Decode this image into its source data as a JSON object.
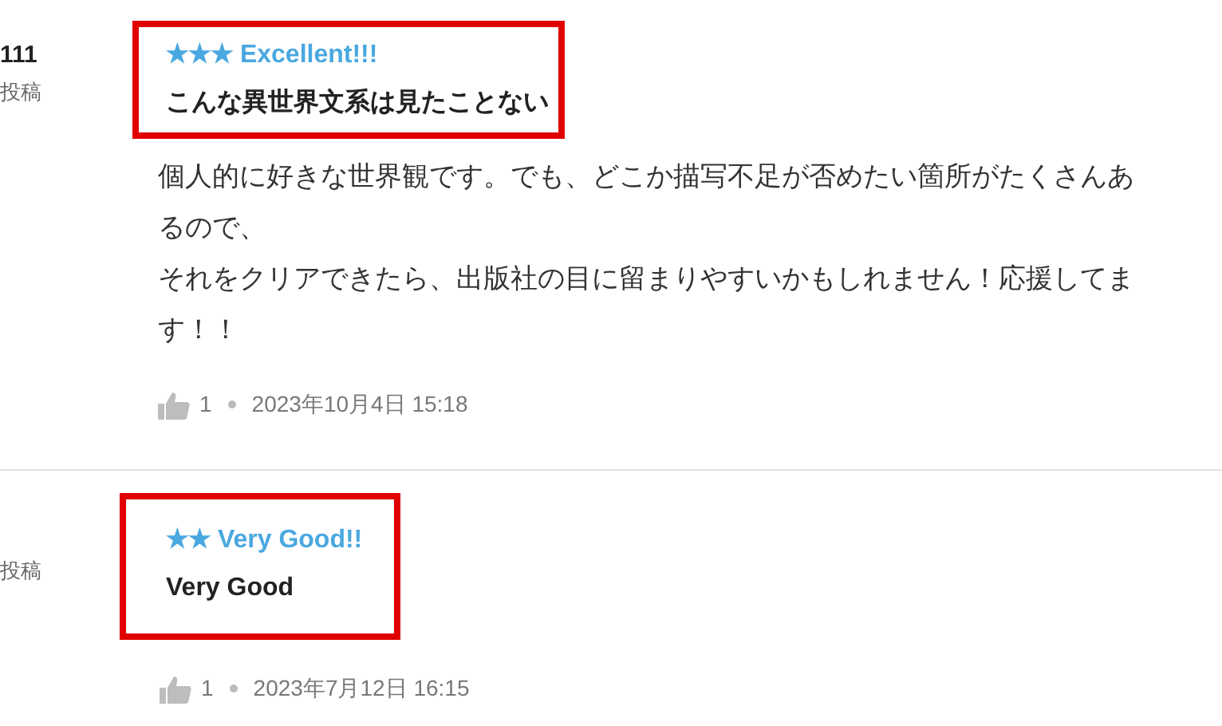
{
  "reviews": [
    {
      "author": "111",
      "posted": "投稿",
      "rating_label": "★★★ Excellent!!!",
      "title": "こんな異世界文系は見たことない",
      "highlighted": true,
      "body": [
        "個人的に好きな世界観です。でも、どこか描写不足が否めたい箇所がたくさんあるので、",
        "それをクリアできたら、出版社の目に留まりやすいかもしれません！応援してます！！"
      ],
      "likes": "1",
      "date": "2023年10月4日 15:18"
    },
    {
      "posted": "投稿",
      "rating_label": "★★ Very Good!!",
      "title": "Very Good",
      "highlighted": true,
      "likes": "1",
      "date": "2023年7月12日 16:15"
    }
  ]
}
